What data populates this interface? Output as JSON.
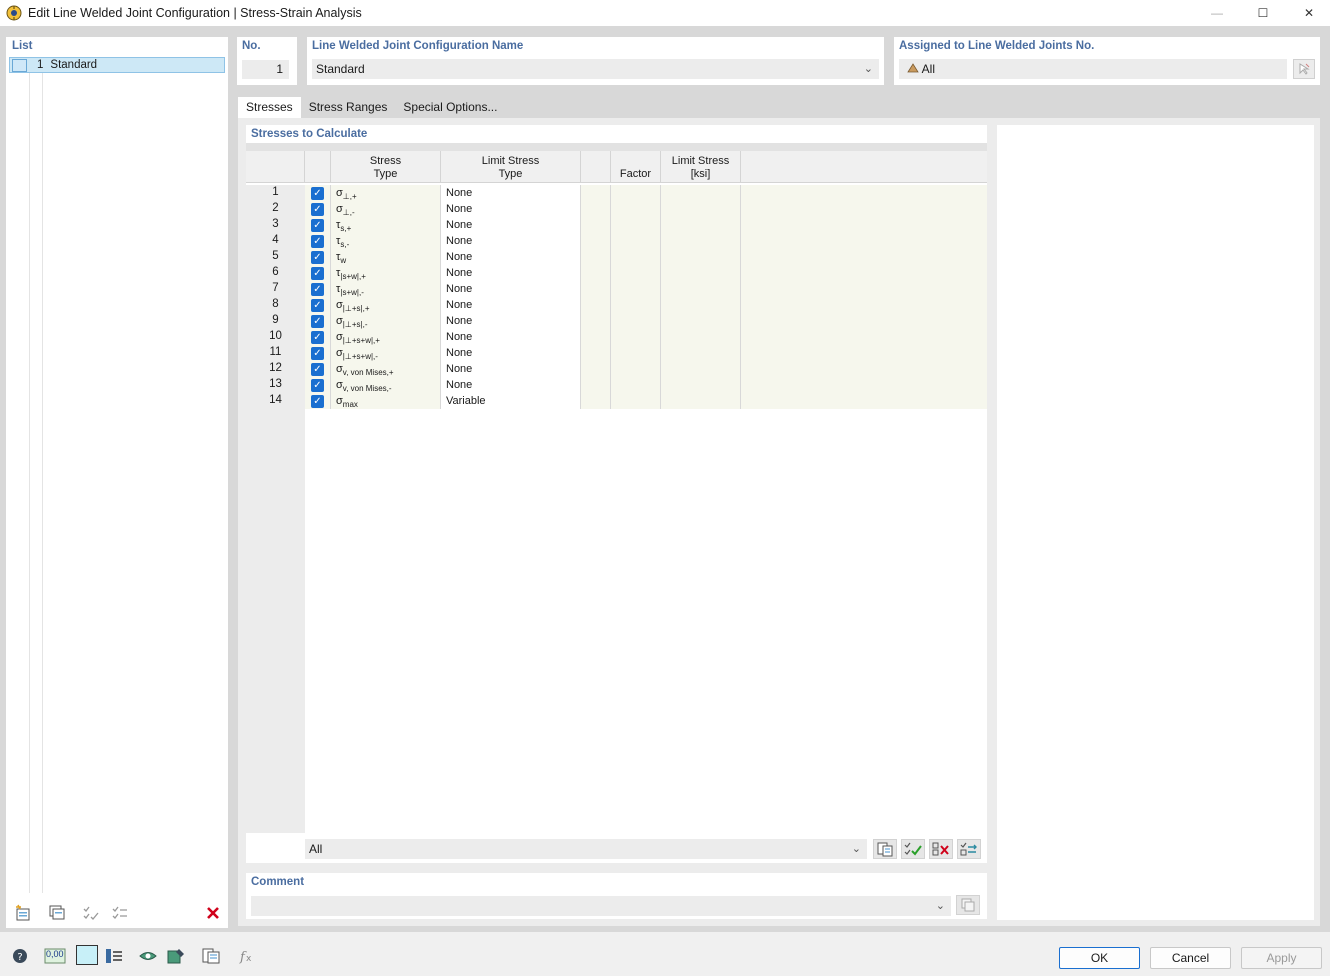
{
  "window": {
    "title": "Edit Line Welded Joint Configuration | Stress-Strain Analysis",
    "minimize_glyph": "—",
    "maximize_glyph": "☐",
    "close_glyph": "✕"
  },
  "list": {
    "label": "List",
    "items": [
      {
        "num": "1",
        "name": "Standard"
      }
    ]
  },
  "header": {
    "no_label": "No.",
    "no_value": "1",
    "name_label": "Line Welded Joint Configuration Name",
    "name_value": "Standard",
    "assigned_label": "Assigned to Line Welded Joints No.",
    "assigned_value": "All"
  },
  "tabs": [
    {
      "label": "Stresses",
      "active": true
    },
    {
      "label": "Stress Ranges",
      "active": false
    },
    {
      "label": "Special Options...",
      "active": false
    }
  ],
  "stresses": {
    "section_label": "Stresses to Calculate",
    "columns": {
      "stress_type_1": "Stress",
      "stress_type_2": "Type",
      "limit_type_1": "Limit Stress",
      "limit_type_2": "Type",
      "factor": "Factor",
      "limit_stress_1": "Limit Stress",
      "limit_stress_2": "[ksi]"
    },
    "rows": [
      {
        "num": "1",
        "base": "σ",
        "sub": "⊥,+",
        "checked": true,
        "limit_type": "None"
      },
      {
        "num": "2",
        "base": "σ",
        "sub": "⊥,-",
        "checked": true,
        "limit_type": "None"
      },
      {
        "num": "3",
        "base": "τ",
        "sub": "s,+",
        "checked": true,
        "limit_type": "None"
      },
      {
        "num": "4",
        "base": "τ",
        "sub": "s,-",
        "checked": true,
        "limit_type": "None"
      },
      {
        "num": "5",
        "base": "τ",
        "sub": "w",
        "checked": true,
        "limit_type": "None"
      },
      {
        "num": "6",
        "base": "τ",
        "sub": "|s+w|,+",
        "checked": true,
        "limit_type": "None"
      },
      {
        "num": "7",
        "base": "τ",
        "sub": "|s+w|,-",
        "checked": true,
        "limit_type": "None"
      },
      {
        "num": "8",
        "base": "σ",
        "sub": "|⊥+s|,+",
        "checked": true,
        "limit_type": "None"
      },
      {
        "num": "9",
        "base": "σ",
        "sub": "|⊥+s|,-",
        "checked": true,
        "limit_type": "None"
      },
      {
        "num": "10",
        "base": "σ",
        "sub": "|⊥+s+w|,+",
        "checked": true,
        "limit_type": "None"
      },
      {
        "num": "11",
        "base": "σ",
        "sub": "|⊥+s+w|,-",
        "checked": true,
        "limit_type": "None"
      },
      {
        "num": "12",
        "base": "σ",
        "sub": "v, von Mises,+",
        "checked": true,
        "limit_type": "None"
      },
      {
        "num": "13",
        "base": "σ",
        "sub": "v, von Mises,-",
        "checked": true,
        "limit_type": "None"
      },
      {
        "num": "14",
        "base": "σ",
        "sub": "max",
        "checked": true,
        "limit_type": "Variable"
      }
    ],
    "filter_value": "All"
  },
  "comment": {
    "label": "Comment",
    "value": ""
  },
  "buttons": {
    "ok": "OK",
    "cancel": "Cancel",
    "apply": "Apply"
  },
  "bottom_tools": {
    "units_label": "0,00"
  },
  "colors": {
    "accent": "#1a6fd0",
    "section_label": "#4a6da0",
    "delete_red": "#d0021b",
    "grid_cell_bg": "#f6f7ed",
    "selection_bg": "#cde8f6"
  }
}
